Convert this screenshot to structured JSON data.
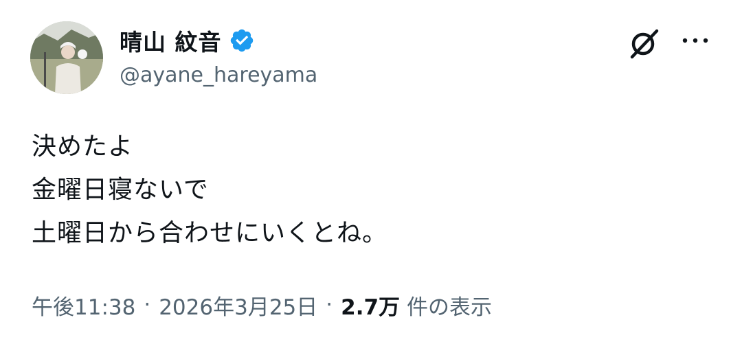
{
  "author": {
    "display_name": "晴山 紋音",
    "handle": "@ayane_hareyama",
    "verified_color": "#1d9bf0"
  },
  "actions": {
    "grok_icon": "grok-slash-icon",
    "more_icon": "more-dots-icon"
  },
  "tweet": {
    "lines": [
      "決めたよ",
      "金曜日寝ないで",
      "土曜日から合わせにいくとね。"
    ]
  },
  "meta": {
    "time": "午後11:38",
    "separator": "·",
    "date": "2026年3月25日",
    "views_count": "2.7万",
    "views_label": "件の表示"
  },
  "colors": {
    "text_primary": "#0f1419",
    "text_secondary": "#536471",
    "accent": "#1d9bf0"
  }
}
